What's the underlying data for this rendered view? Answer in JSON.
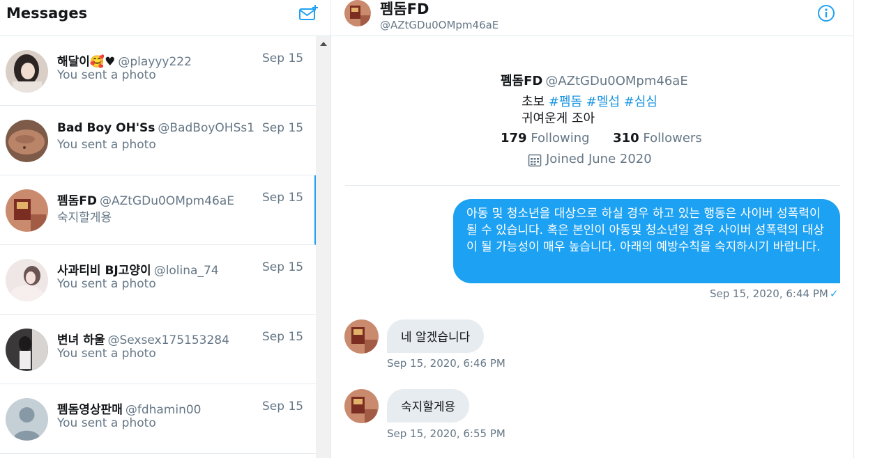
{
  "sidebar": {
    "title": "Messages",
    "compose_icon": "new-message-icon",
    "conversations": [
      {
        "name": "해달이🥰♥",
        "handle": "@playyy222",
        "date": "Sep 15",
        "preview": "You sent a photo",
        "active": false
      },
      {
        "name": "Bad Boy OH'Ss",
        "handle": "@BadBoyOHSs1",
        "date": "Sep 15",
        "preview": "You sent a photo",
        "active": false
      },
      {
        "name": "펨돔FD",
        "handle": "@AZtGDu0OMpm46aE",
        "date": "Sep 15",
        "preview": "숙지할게용",
        "active": true
      },
      {
        "name": "사과티비 BJ고양이",
        "handle": "@lolina_74",
        "date": "Sep 15",
        "preview": "You sent a photo",
        "active": false
      },
      {
        "name": "변녀 하울",
        "handle": "@Sexsex175153284",
        "date": "Sep 15",
        "preview": "You sent a photo",
        "active": false
      },
      {
        "name": "펨돔영상판매",
        "handle": "@fdhamin00",
        "date": "Sep 15",
        "preview": "You sent a photo",
        "active": false
      }
    ]
  },
  "chat": {
    "header": {
      "name": "펨돔FD",
      "handle": "@AZtGDu0OMpm46aE",
      "info_icon": "info-icon"
    },
    "profile": {
      "name": "펨돔FD",
      "handle": "@AZtGDu0OMpm46aE",
      "bio_prefix": "초보",
      "bio_tags": [
        "#펨돔",
        "#멜섭",
        "#심심"
      ],
      "bio_line2": "귀여운게 조아",
      "following_count": "179",
      "following_label": "Following",
      "followers_count": "310",
      "followers_label": "Followers",
      "joined": "Joined June 2020"
    },
    "messages": [
      {
        "direction": "out",
        "text": "아동 및 청소년을 대상으로 하실 경우 하고 있는 행동은 사이버 성폭력이 될 수 있습니다. 혹은 본인이 아동및 청소년일 경우 사이버 성폭력의 대상이 될 가능성이 매우 높습니다. 아래의 예방수칙을 숙지하시기 바랍니다.",
        "time": "Sep 15, 2020, 6:44 PM",
        "status": "✓"
      },
      {
        "direction": "in",
        "text": "네 알겠습니다",
        "time": "Sep 15, 2020, 6:46 PM"
      },
      {
        "direction": "in",
        "text": "숙지할게용",
        "time": "Sep 15, 2020, 6:55 PM"
      }
    ]
  },
  "colors": {
    "accent": "#1da1f2",
    "muted": "#657786",
    "border": "#e6ecf0",
    "bubble_in": "#e6ecf0"
  }
}
